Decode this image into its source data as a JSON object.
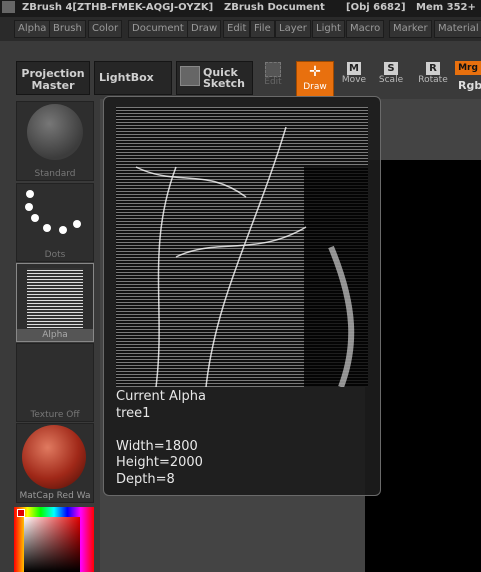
{
  "titlebar": {
    "app": "ZBrush 4[ZTHB-FMEK-AQGJ-OYZK]",
    "doc": "ZBrush Document",
    "obj": "[Obj 6682]",
    "mem": "Mem 352+"
  },
  "menu": [
    "Alpha",
    "Brush",
    "Color",
    "Document",
    "Draw",
    "Edit",
    "File",
    "Layer",
    "Light",
    "Macro",
    "Marker",
    "Material"
  ],
  "toolbar": {
    "projection_master": "Projection\nMaster",
    "lightbox": "LightBox",
    "quick_sketch": "Quick\nSketch",
    "edit": "Edit",
    "draw": "Draw",
    "move": "Move",
    "scale": "Scale",
    "rotate": "Rotate",
    "mrg": "Mrg",
    "rgb": "Rgb"
  },
  "left_panel": {
    "standard": "Standard",
    "dots": "Dots",
    "alpha": "Alpha",
    "texture": "Texture Off",
    "matcap": "MatCap Red Wa"
  },
  "tooltip": {
    "heading": "Current Alpha",
    "name": "tree1",
    "width": "Width=1800",
    "height": "Height=2000",
    "depth": "Depth=8"
  },
  "colors": {
    "accent": "#e8700e",
    "background": "#3a3a3a"
  }
}
